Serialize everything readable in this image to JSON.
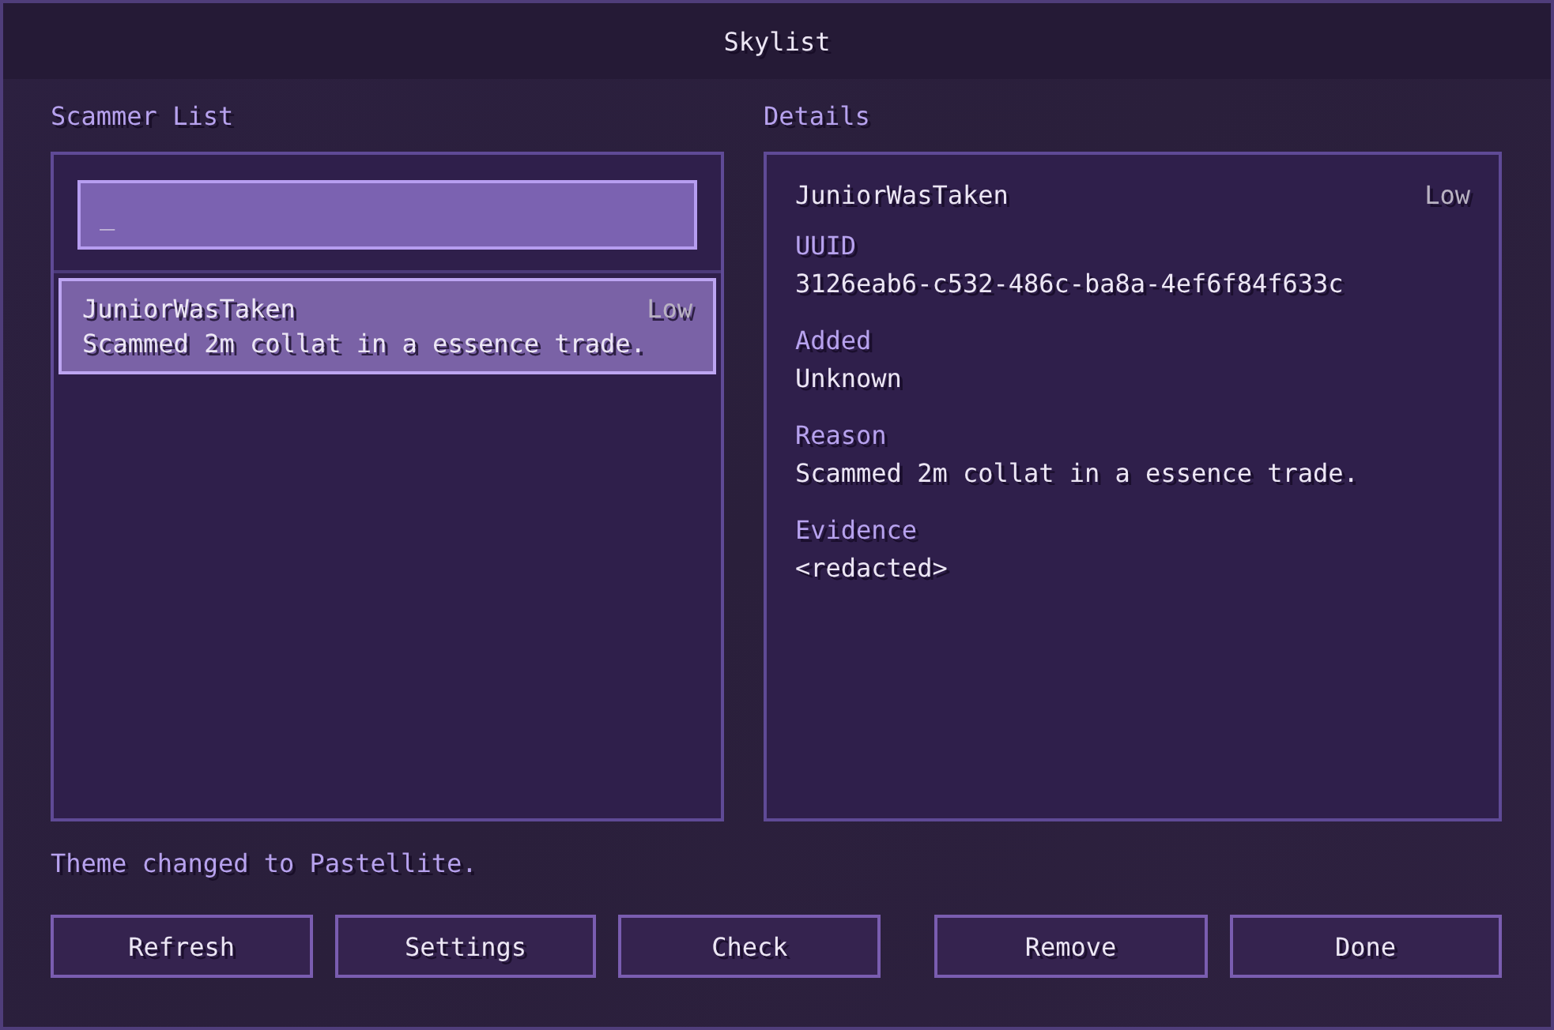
{
  "window": {
    "title": "Skylist"
  },
  "scammer_list": {
    "label": "Scammer List",
    "search": {
      "value": "_"
    },
    "items": [
      {
        "name": "JuniorWasTaken",
        "severity": "Low",
        "reason": "Scammed 2m collat in a essence trade.",
        "selected": true
      }
    ]
  },
  "details": {
    "label": "Details",
    "name": "JuniorWasTaken",
    "severity": "Low",
    "fields": [
      {
        "label": "UUID",
        "value": "3126eab6-c532-486c-ba8a-4ef6f84f633c"
      },
      {
        "label": "Added",
        "value": "Unknown"
      },
      {
        "label": "Reason",
        "value": "Scammed 2m collat in a essence trade."
      },
      {
        "label": "Evidence",
        "value": "<redacted>"
      }
    ]
  },
  "status": "Theme changed to Pastellite.",
  "left_buttons": [
    {
      "label": "Refresh"
    },
    {
      "label": "Settings"
    },
    {
      "label": "Check"
    }
  ],
  "right_buttons": [
    {
      "label": "Remove"
    },
    {
      "label": "Done"
    }
  ]
}
